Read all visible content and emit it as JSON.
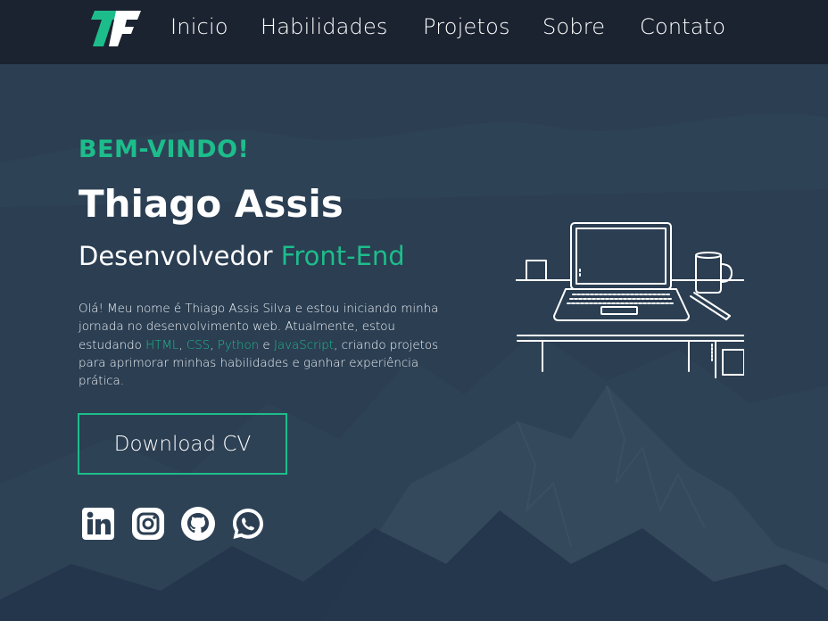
{
  "nav": {
    "logo_text": "TF",
    "items": [
      {
        "label": "Inicio"
      },
      {
        "label": "Habilidades"
      },
      {
        "label": "Projetos"
      },
      {
        "label": "Sobre"
      },
      {
        "label": "Contato"
      }
    ]
  },
  "hero": {
    "welcome": "BEM-VINDO!",
    "name": "Thiago Assis",
    "role_prefix": "Desenvolvedor",
    "role_accent": "Front-End",
    "bio": {
      "part1": "Olá! Meu nome é Thiago Assis Silva e estou iniciando minha jornada no desenvolvimento web. Atualmente, estou estudando ",
      "html": "HTML",
      "sep1": ", ",
      "css": "CSS",
      "sep2": ", ",
      "python": "Python",
      "sep3": " e ",
      "javascript": "JavaScript",
      "part2": ", criando projetos para aprimorar minhas habilidades e ganhar experiência prática."
    },
    "cv_button": "Download CV"
  },
  "socials": [
    {
      "icon": "linkedin-icon"
    },
    {
      "icon": "instagram-icon"
    },
    {
      "icon": "github-icon"
    },
    {
      "icon": "whatsapp-icon"
    }
  ],
  "colors": {
    "accent": "#1dbd8b",
    "nav_bg": "#1b2330",
    "page_bg": "#2b3e52"
  }
}
